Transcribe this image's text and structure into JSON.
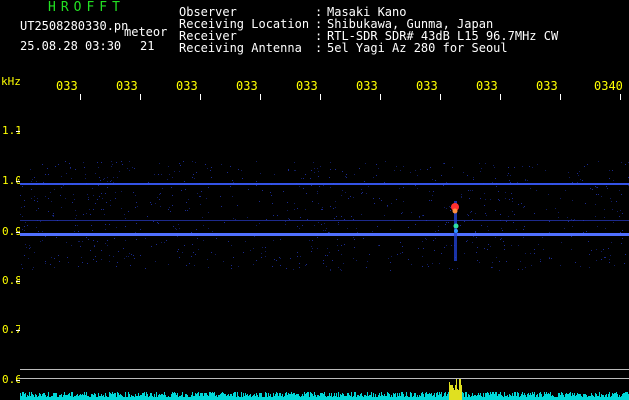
{
  "header": {
    "brand": "HROFFT",
    "filename": "UT2508280330.pn",
    "type_label": "meteor",
    "datetime": "25.08.28 03:30",
    "count": "21"
  },
  "meta": {
    "labels": [
      "Observer",
      "Receiving Location",
      "Receiver",
      "Receiving Antenna"
    ],
    "separator": ":",
    "values": [
      "Masaki Kano",
      "Shibukawa, Gunma, Japan",
      "RTL-SDR SDR# 43dB L15 96.7MHz CW",
      "5el Yagi Az 280 for Seoul"
    ]
  },
  "axis": {
    "y_unit": "kHz",
    "y_ticks": [
      "1.1",
      "1.0",
      "0.9",
      "0.8",
      "0.7",
      "0.6"
    ],
    "x_ticks": [
      "033",
      "033",
      "033",
      "033",
      "033",
      "033",
      "033",
      "033",
      "033",
      "0340"
    ]
  },
  "colors": {
    "background": "#000000",
    "text_white": "#ffffff",
    "text_yellow": "#ffff00",
    "brand_green": "#22e022",
    "signal_blue": "#3050ff",
    "noise_cyan": "#00e0e0",
    "meteor_red": "#ff3030"
  }
}
